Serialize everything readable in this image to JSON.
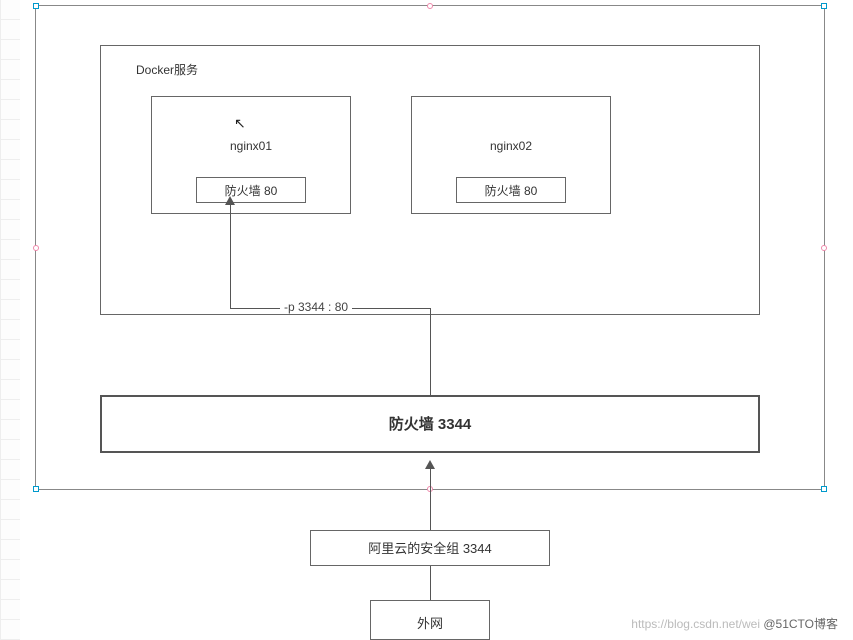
{
  "docker": {
    "label": "Docker服务",
    "containers": [
      {
        "name": "nginx01",
        "firewall": "防火墙  80"
      },
      {
        "name": "nginx02",
        "firewall": "防火墙  80"
      }
    ],
    "port_mapping": "-p 3344 : 80"
  },
  "firewall": {
    "label": "防火墙   3344"
  },
  "security_group": {
    "label": "阿里云的安全组   3344"
  },
  "internet": {
    "label": "外网"
  },
  "watermark": {
    "faint": "https://blog.csdn.net/wei ",
    "dark": "@51CTO博客"
  },
  "footer": {
    "cropped_text": ""
  },
  "chart_data": {
    "type": "diagram",
    "title": "Docker port mapping network flow",
    "nodes": [
      {
        "id": "internet",
        "label": "外网"
      },
      {
        "id": "security_group",
        "label": "阿里云的安全组 3344",
        "port": 3344
      },
      {
        "id": "host_firewall",
        "label": "防火墙 3344",
        "port": 3344
      },
      {
        "id": "docker_host",
        "label": "Docker服务"
      },
      {
        "id": "nginx01",
        "label": "nginx01",
        "firewall_port": 80
      },
      {
        "id": "nginx02",
        "label": "nginx02",
        "firewall_port": 80
      }
    ],
    "edges": [
      {
        "from": "internet",
        "to": "security_group"
      },
      {
        "from": "security_group",
        "to": "host_firewall"
      },
      {
        "from": "host_firewall",
        "to": "nginx01",
        "label": "-p 3344:80"
      }
    ]
  }
}
